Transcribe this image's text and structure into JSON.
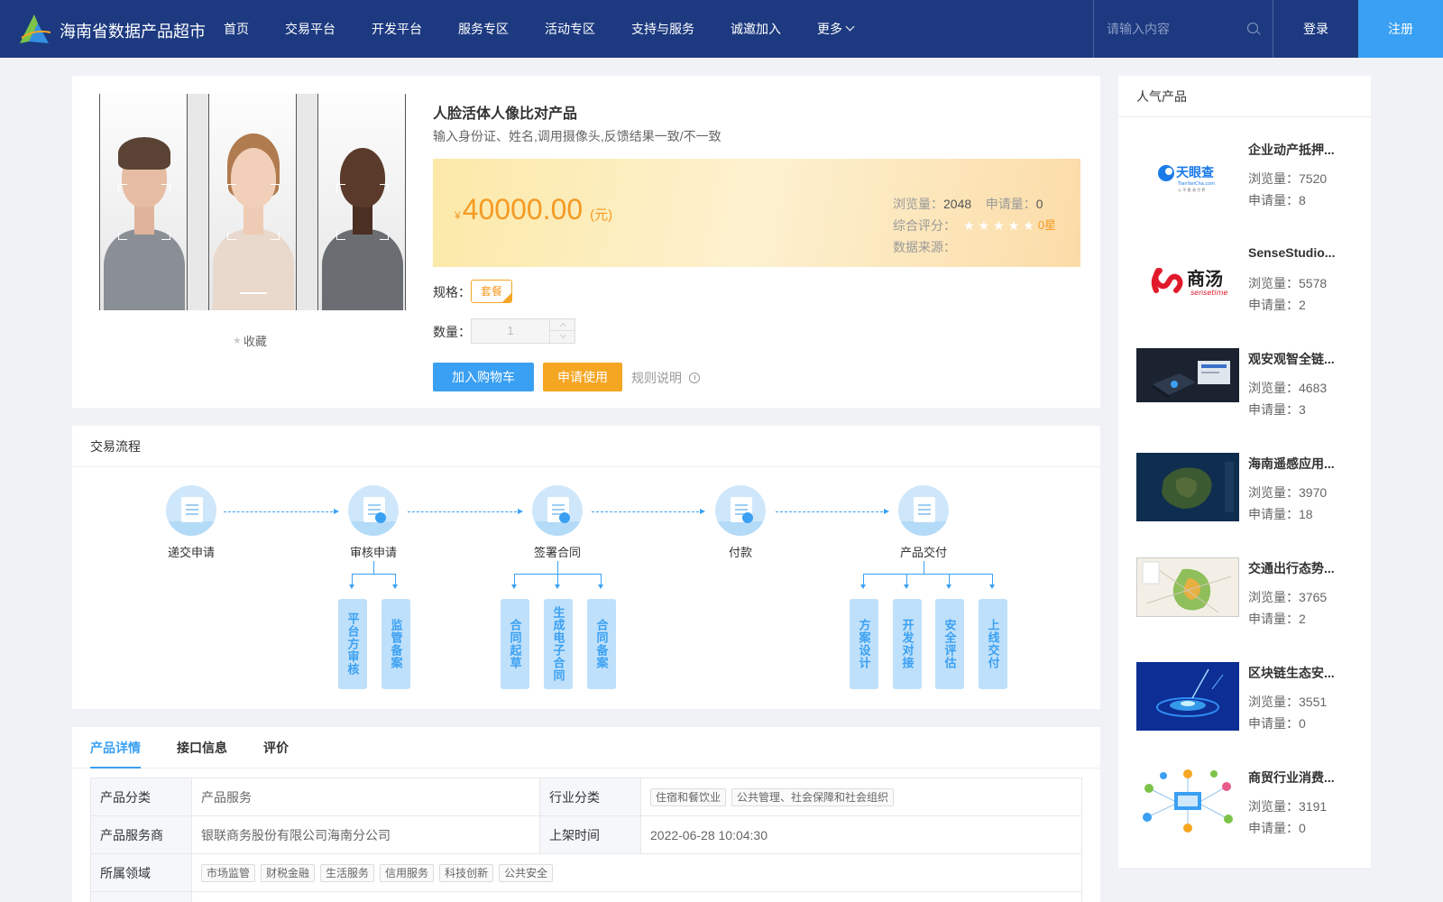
{
  "header": {
    "title": "海南省数据产品超市",
    "nav": [
      "首页",
      "交易平台",
      "开发平台",
      "服务专区",
      "活动专区",
      "支持与服务",
      "诚邀加入",
      "更多"
    ],
    "search_placeholder": "请输入内容",
    "login": "登录",
    "register": "注册"
  },
  "product": {
    "title": "人脸活体人像比对产品",
    "description": "输入身份证、姓名,调用摄像头,反馈结果一致/不一致",
    "favorite": "收藏",
    "price_symbol": "¥",
    "price": "40000.00",
    "price_unit": "(元)",
    "views_label": "浏览量：",
    "views": "2048",
    "applies_label": "申请量：",
    "applies": "0",
    "rating_label": "综合评分：",
    "rating_value": "0星",
    "rating_stars": 0,
    "source_label": "数据来源：",
    "spec_label": "规格：",
    "spec_value": "套餐",
    "qty_label": "数量：",
    "qty_value": "1",
    "cart_button": "加入购物车",
    "apply_button": "申请使用",
    "rules_link": "规则说明"
  },
  "flow": {
    "title": "交易流程",
    "steps": [
      "递交申请",
      "审核申请",
      "签署合同",
      "付款",
      "产品交付"
    ],
    "substeps": {
      "review": [
        "平台方审核",
        "监管备案"
      ],
      "contract": [
        "合同起草",
        "生成电子合同",
        "合同备案"
      ],
      "delivery": [
        "方案设计",
        "开发对接",
        "安全评估",
        "上线交付"
      ]
    }
  },
  "details": {
    "tabs": [
      "产品详情",
      "接口信息",
      "评价"
    ],
    "rows": {
      "category_label": "产品分类",
      "category": "产品服务",
      "industry_label": "行业分类",
      "industry_tags": [
        "住宿和餐饮业",
        "公共管理、社会保障和社会组织"
      ],
      "provider_label": "产品服务商",
      "provider": "银联商务股份有限公司海南分公司",
      "listed_label": "上架时间",
      "listed": "2022-06-28 10:04:30",
      "domain_label": "所属领域",
      "domain_tags": [
        "市场监管",
        "财税金融",
        "生活服务",
        "信用服务",
        "科技创新",
        "公共安全"
      ]
    }
  },
  "popular": {
    "title": "人气产品",
    "views_label": "浏览量：",
    "applies_label": "申请量：",
    "items": [
      {
        "name": "企业动产抵押...",
        "views": "7520",
        "applies": "8",
        "thumb": "tianyancha"
      },
      {
        "name": "SenseStudio...",
        "views": "5578",
        "applies": "2",
        "thumb": "sensetime"
      },
      {
        "name": "观安观智全链...",
        "views": "4683",
        "applies": "3",
        "thumb": "devices"
      },
      {
        "name": "海南遥感应用...",
        "views": "3970",
        "applies": "18",
        "thumb": "satellite"
      },
      {
        "name": "交通出行态势...",
        "views": "3765",
        "applies": "2",
        "thumb": "map"
      },
      {
        "name": "区块链生态安...",
        "views": "3551",
        "applies": "0",
        "thumb": "blockchain"
      },
      {
        "name": "商贸行业消费...",
        "views": "3191",
        "applies": "0",
        "thumb": "network"
      }
    ],
    "thumb_labels": {
      "tianyancha_cn": "天眼查",
      "tianyancha_en": "TianYanCha.com",
      "tianyancha_sub": "公 平 看 清 世 界",
      "sensetime_cn": "商汤",
      "sensetime_en": "sensetime"
    }
  },
  "colors": {
    "header_bg": "#1d3a80",
    "accent_blue": "#3aa0f3",
    "accent_orange": "#f5a623"
  }
}
